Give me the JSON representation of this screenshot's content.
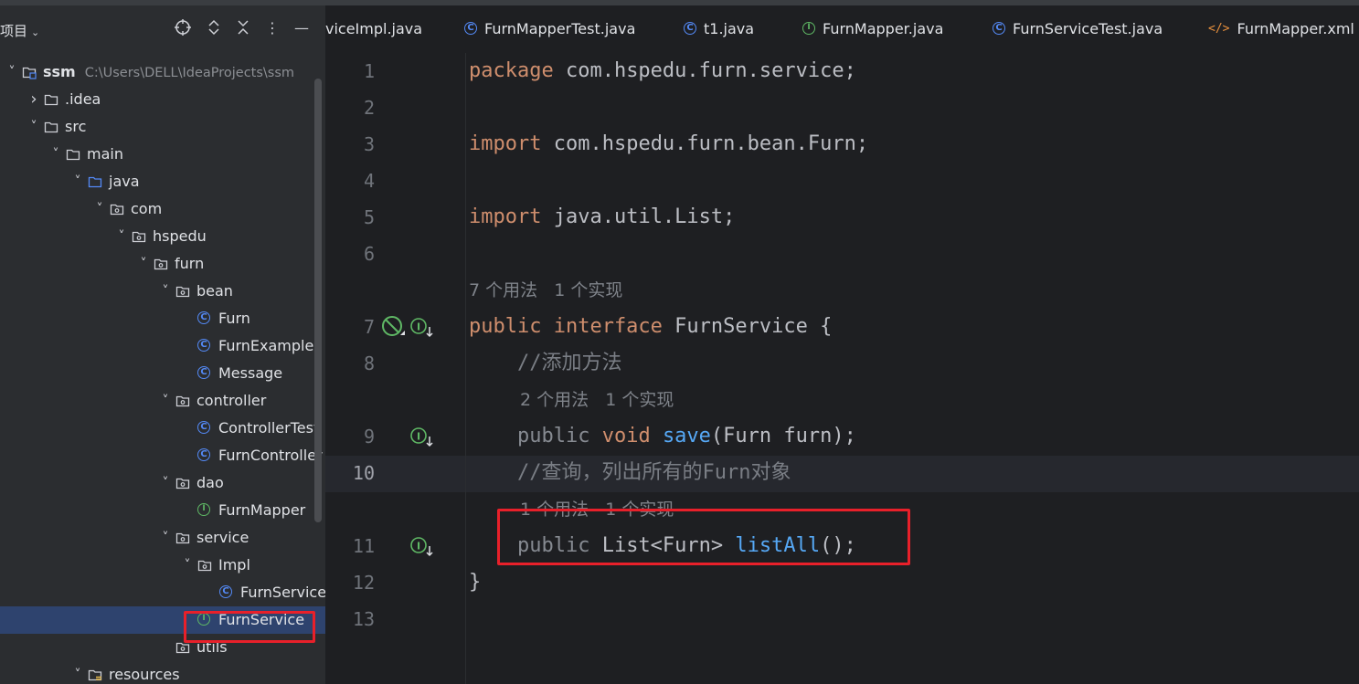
{
  "project_panel": {
    "title": "项目",
    "toolbar_icons": [
      "locate-icon",
      "expand-collapse-icon",
      "collapse-all-icon",
      "more-icon",
      "minimize-icon"
    ],
    "tree": [
      {
        "label": "ssm",
        "path": "C:\\Users\\DELL\\IdeaProjects\\ssm",
        "icon": "module-folder",
        "expanded": true,
        "bold": true
      },
      {
        "label": ".idea",
        "icon": "folder",
        "expanded": false
      },
      {
        "label": "src",
        "icon": "folder",
        "expanded": true
      },
      {
        "label": "main",
        "icon": "folder",
        "expanded": true
      },
      {
        "label": "java",
        "icon": "source-folder",
        "expanded": true
      },
      {
        "label": "com",
        "icon": "package",
        "expanded": true
      },
      {
        "label": "hspedu",
        "icon": "package",
        "expanded": true
      },
      {
        "label": "furn",
        "icon": "package",
        "expanded": true
      },
      {
        "label": "bean",
        "icon": "package",
        "expanded": true
      },
      {
        "label": "Furn",
        "icon": "class"
      },
      {
        "label": "FurnExample",
        "icon": "class"
      },
      {
        "label": "Message",
        "icon": "class"
      },
      {
        "label": "controller",
        "icon": "package",
        "expanded": true
      },
      {
        "label": "ControllerTest",
        "icon": "class"
      },
      {
        "label": "FurnController",
        "icon": "class"
      },
      {
        "label": "dao",
        "icon": "package",
        "expanded": true
      },
      {
        "label": "FurnMapper",
        "icon": "interface"
      },
      {
        "label": "service",
        "icon": "package",
        "expanded": true
      },
      {
        "label": "Impl",
        "icon": "package",
        "expanded": true
      },
      {
        "label": "FurnServiceI",
        "icon": "class"
      },
      {
        "label": "FurnService",
        "icon": "interface",
        "selected": true
      },
      {
        "label": "utils",
        "icon": "package"
      },
      {
        "label": "resources",
        "icon": "resources-folder",
        "expanded": true
      }
    ]
  },
  "tabs": [
    {
      "label": "viceImpl.java",
      "icon": "none"
    },
    {
      "label": "FurnMapperTest.java",
      "icon": "class"
    },
    {
      "label": "t1.java",
      "icon": "class"
    },
    {
      "label": "FurnMapper.java",
      "icon": "interface"
    },
    {
      "label": "FurnServiceTest.java",
      "icon": "class"
    },
    {
      "label": "FurnMapper.xml",
      "icon": "xml"
    }
  ],
  "editor": {
    "current_line": "10",
    "lines": [
      {
        "n": "1",
        "parts": [
          [
            "kw",
            "package"
          ],
          [
            "pl",
            " com.hspedu.furn.service;"
          ]
        ]
      },
      {
        "n": "2",
        "parts": []
      },
      {
        "n": "3",
        "parts": [
          [
            "kw",
            "import"
          ],
          [
            "pl",
            " com.hspedu.furn.bean.Furn;"
          ]
        ]
      },
      {
        "n": "4",
        "parts": []
      },
      {
        "n": "5",
        "parts": [
          [
            "kw",
            "import"
          ],
          [
            "pl",
            " java.util.List;"
          ]
        ]
      },
      {
        "n": "6",
        "parts": []
      },
      {
        "n": "7",
        "parts": [
          [
            "kw",
            "public interface"
          ],
          [
            "pl",
            " FurnService {"
          ]
        ]
      },
      {
        "n": "8",
        "parts": [
          [
            "pl",
            "    "
          ],
          [
            "cm",
            "//添加方法"
          ]
        ]
      },
      {
        "n": "9",
        "parts": [
          [
            "pl",
            "    "
          ],
          [
            "dim",
            "public "
          ],
          [
            "kw",
            "void "
          ],
          [
            "fn",
            "save"
          ],
          [
            "pl",
            "(Furn furn);"
          ]
        ]
      },
      {
        "n": "10",
        "parts": [
          [
            "pl",
            "    "
          ],
          [
            "cm",
            "//查询，列出所有的Furn对象"
          ]
        ]
      },
      {
        "n": "11",
        "parts": [
          [
            "pl",
            "    "
          ],
          [
            "dim",
            "public "
          ],
          [
            "pl",
            "List<Furn> "
          ],
          [
            "fn",
            "listAll"
          ],
          [
            "pl",
            "();"
          ]
        ]
      },
      {
        "n": "12",
        "parts": [
          [
            "pl",
            "}"
          ]
        ]
      },
      {
        "n": "13",
        "parts": []
      }
    ],
    "hints": [
      {
        "before_line": "7",
        "text": "7 个用法   1 个实现"
      },
      {
        "before_line": "9",
        "text": "2 个用法   1 个实现"
      },
      {
        "before_line": "11",
        "text": "1 个用法   1 个实现"
      }
    ]
  },
  "colors": {
    "keyword": "#cf8e6d",
    "function": "#56a8f5",
    "comment": "#7a7e85",
    "selection": "#2e436e",
    "annotation_box": "#e8202a"
  }
}
